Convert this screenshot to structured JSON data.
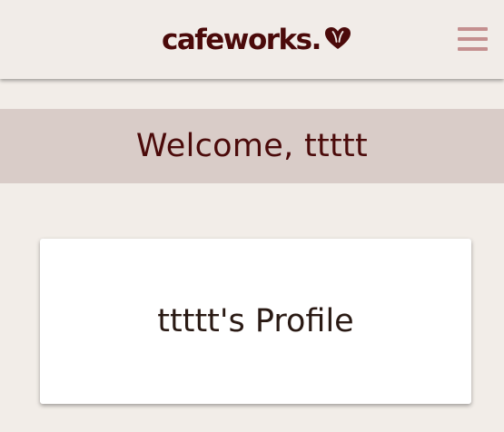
{
  "header": {
    "logo_text": "cafeworks.",
    "logo_icon": "coffee-bean-heart-icon",
    "menu_icon": "hamburger-menu-icon"
  },
  "welcome": {
    "text": "Welcome, ttttt"
  },
  "profile": {
    "title": "ttttt's Profile"
  },
  "colors": {
    "brand": "#4b0a0a",
    "menu_icon": "#c48f8f",
    "header_bg": "#f1ece8",
    "welcome_bg": "#d9ccc8",
    "page_bg": "#f2ede8",
    "card_bg": "#ffffff"
  }
}
